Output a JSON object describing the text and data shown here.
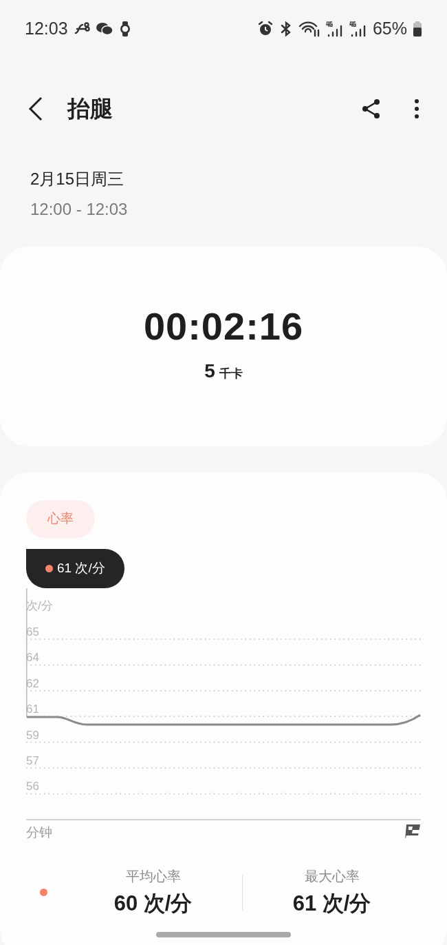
{
  "status_bar": {
    "time": "12:03",
    "battery": "65%"
  },
  "header": {
    "title": "抬腿"
  },
  "session": {
    "date": "2月15日周三",
    "time_range": "12:00 - 12:03"
  },
  "summary": {
    "duration": "00:02:16",
    "calories": "5",
    "calories_unit": "千卡"
  },
  "heart_rate": {
    "chip": {
      "label": "心率",
      "selected": true
    },
    "tooltip": {
      "text": "61 次/分"
    },
    "chart": {
      "unit_label": "次/分",
      "x_label": "分钟",
      "y_axis_labels": [
        "65",
        "64",
        "62",
        "61",
        "59",
        "57",
        "56"
      ]
    },
    "stats": [
      {
        "label": "平均心率",
        "value": "60 次/分"
      },
      {
        "label": "最大心率",
        "value": "61 次/分"
      }
    ]
  }
}
